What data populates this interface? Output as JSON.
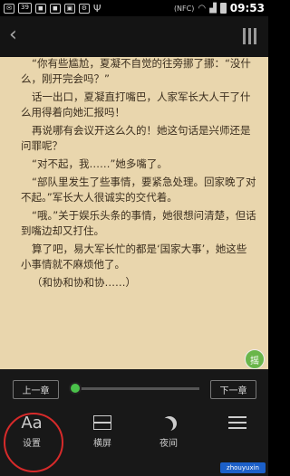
{
  "status_bar": {
    "signal": "39",
    "icons": [
      "notification-icon",
      "notification-icon",
      "notification-icon",
      "notification-icon",
      "usb-icon",
      "wifi-icon",
      "battery-icon"
    ],
    "nfc": "(NFC)",
    "time": "09:53"
  },
  "reader": {
    "paragraphs": [
      "“你有些尴尬，夏凝不自觉的往旁挪了挪：“没什么，刚开完会吗？”",
      "话一出口，夏凝直打嘴巴，人家军长大人干了什么用得着向她汇报吗！",
      "再说哪有会议开这么久的！她这句话是兴师还是问罪呢？",
      "“对不起，我……”她多嘴了。",
      "“部队里发生了些事情，要紧急处理。回家晚了对不起。”军长大人很诚实的交代着。",
      "“哦。”关于娱乐头条的事情，她很想问清楚，但话到嘴边却又打住。",
      "算了吧，易大军长忙的都是‘国家大事’，她这些小事情就不麻烦他了。",
      "（和协和协和协……）"
    ],
    "float_label": "摇"
  },
  "controls": {
    "prev_chapter": "上一章",
    "next_chapter": "下一章",
    "progress": 0.0,
    "tabs": [
      {
        "label": "设置",
        "icon": "Aa"
      },
      {
        "label": "横屏",
        "icon": "layout-icon"
      },
      {
        "label": "夜间",
        "icon": "moon-icon"
      },
      {
        "label": "",
        "icon": "more-icon"
      }
    ]
  },
  "watermark": "zhouyuxin"
}
